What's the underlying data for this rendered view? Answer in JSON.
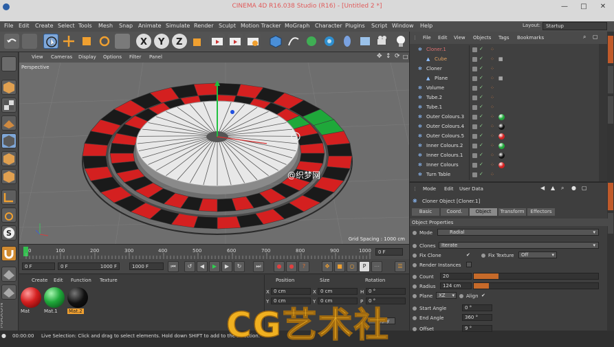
{
  "window": {
    "title": "CINEMA 4D R16.038 Studio (R16) - [Untitled 2 *]"
  },
  "menubar": {
    "items": [
      "File",
      "Edit",
      "Create",
      "Select",
      "Tools",
      "Mesh",
      "Snap",
      "Animate",
      "Simulate",
      "Render",
      "Sculpt",
      "Motion Tracker",
      "MoGraph",
      "Character",
      "Plugins",
      "Script",
      "Window",
      "Help"
    ],
    "layout_label": "Layout:",
    "layout_value": "Startup"
  },
  "viewport": {
    "menu": [
      "View",
      "Cameras",
      "Display",
      "Options",
      "Filter",
      "Panel"
    ],
    "label": "Perspective",
    "grid_spacing": "Grid Spacing : 1000 cm"
  },
  "timeline": {
    "ticks": [
      "0",
      "100",
      "200",
      "300",
      "400",
      "500",
      "600",
      "700",
      "800",
      "900",
      "1000"
    ],
    "current_frame_box": "0 F",
    "start_field": "0 F",
    "preview_start": "0 F",
    "preview_end": "1000 F",
    "end_field": "1000 F"
  },
  "materials": {
    "menu": [
      "Create",
      "Edit",
      "Function",
      "Texture"
    ],
    "items": [
      {
        "label": "Mat",
        "color": "#d42020"
      },
      {
        "label": "Mat.1",
        "color": "#1fa83a"
      },
      {
        "label": "Mat.2",
        "color": "#111111"
      }
    ]
  },
  "coords": {
    "headers": [
      "Position",
      "Size",
      "Rotation"
    ],
    "rows": [
      {
        "axis": "X",
        "pos": "0 cm",
        "size_axis": "X",
        "size": "0 cm",
        "rot_axis": "H",
        "rot": "0 °"
      },
      {
        "axis": "Y",
        "pos": "0 cm",
        "size_axis": "Y",
        "size": "0 cm",
        "rot_axis": "P",
        "rot": "0 °"
      }
    ],
    "apply_label": "Apply"
  },
  "status": {
    "time": "00:00:00",
    "message": "Live Selection: Click and drag to select elements. Hold down SHIFT to add to the selection."
  },
  "object_manager": {
    "menu": [
      "File",
      "Edit",
      "View",
      "Objects",
      "Tags",
      "Bookmarks"
    ],
    "objects": [
      {
        "name": "Cloner.1",
        "color": "#e07070",
        "indent": 0
      },
      {
        "name": "Cube",
        "color": "#e0a060",
        "indent": 1
      },
      {
        "name": "Cloner",
        "color": "#e0e0e0",
        "indent": 0
      },
      {
        "name": "Plane",
        "color": "#e0e0e0",
        "indent": 1
      },
      {
        "name": "Volume",
        "color": "#e0e0e0",
        "indent": 0
      },
      {
        "name": "Tube.2",
        "color": "#e0e0e0",
        "indent": 0
      },
      {
        "name": "Tube.1",
        "color": "#e0e0e0",
        "indent": 0
      },
      {
        "name": "Outer Colours.3",
        "color": "#e0e0e0",
        "indent": 0
      },
      {
        "name": "Outer Colours.4",
        "color": "#e0e0e0",
        "indent": 0
      },
      {
        "name": "Outer Colours.5",
        "color": "#e0e0e0",
        "indent": 0
      },
      {
        "name": "Inner Colours.2",
        "color": "#e0e0e0",
        "indent": 0
      },
      {
        "name": "Inner Colours.1",
        "color": "#e0e0e0",
        "indent": 0
      },
      {
        "name": "Inner Colours",
        "color": "#e0e0e0",
        "indent": 0
      },
      {
        "name": "Turn Table",
        "color": "#e0e0e0",
        "indent": 0
      }
    ],
    "tag_colors": [
      "none",
      "none",
      "none",
      "none",
      "none",
      "none",
      "none",
      "#1fa83a",
      "#111111",
      "#d42020",
      "#1fa83a",
      "#111111",
      "#d42020",
      "none"
    ]
  },
  "attributes": {
    "menu": [
      "Mode",
      "Edit",
      "User Data"
    ],
    "object_title": "Cloner Object [Cloner.1]",
    "tabs": [
      "Basic",
      "Coord.",
      "Object",
      "Transform",
      "Effectors"
    ],
    "active_tab": "Object",
    "section": "Object Properties",
    "mode_label": "Mode",
    "mode_value": "Radial",
    "clones_label": "Clones",
    "clones_value": "Iterate",
    "fix_clone_label": "Fix Clone",
    "fix_texture_label": "Fix Texture",
    "fix_texture_value": "Off",
    "render_instances_label": "Render Instances",
    "count_label": "Count",
    "count_value": "20",
    "radius_label": "Radius",
    "radius_value": "124 cm",
    "plane_label": "Plane",
    "plane_value": "XZ",
    "align_label": "Align",
    "start_angle_label": "Start Angle",
    "start_angle_value": "0 °",
    "end_angle_label": "End Angle",
    "end_angle_value": "360 °",
    "offset_label": "Offset",
    "offset_value": "9 °"
  },
  "watermark": {
    "text": "CG艺术社",
    "overlay": "@织梦网"
  }
}
